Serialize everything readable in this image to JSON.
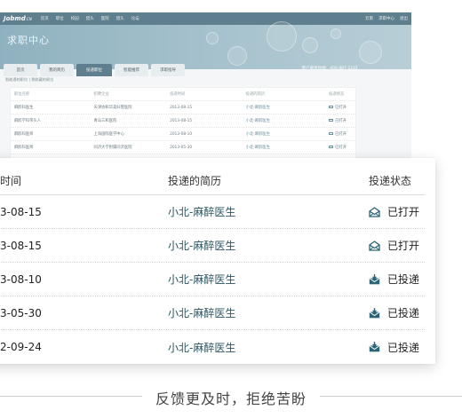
{
  "background_page": {
    "logo": "Jobmd",
    "logo_suffix": ".CN",
    "nav_items": [
      "首页",
      "职位",
      "校园",
      "猎头",
      "医院",
      "猎头",
      "论坛"
    ],
    "nav_right": [
      "云南",
      "求职中心",
      "退出"
    ],
    "page_title": "求职中心",
    "hotline": "客户服务热线：400-887-1101",
    "tabs": [
      "首页",
      "我的简历",
      "投递职位",
      "智能推荐",
      "求职指导"
    ],
    "active_tab": 2,
    "breadcrumb": "智能通的职位 | 我收藏的职位",
    "table": {
      "headers": [
        "职位名称",
        "招聘企业",
        "投递时间",
        "投递的简历",
        "投递状态"
      ],
      "rows": [
        [
          "麻醉科医生",
          "天津协和华美妇婴医院",
          "2013-08-15",
          "小北-麻醉医生",
          "已打开"
        ],
        [
          "麻醉学科带头人",
          "青岛三和医院",
          "2013-08-15",
          "小北-麻醉医生",
          "已打开"
        ],
        [
          "麻醉科医师",
          "上海国际医学中心",
          "2013-08-10",
          "小北-麻醉医生",
          "已打开"
        ],
        [
          "麻醉科医师",
          "同济大学附属同济医院",
          "2013-05-30",
          "小北-麻醉医生",
          "已打开"
        ]
      ]
    }
  },
  "detail_table": {
    "headers": {
      "time": "时间",
      "resume": "投递的简历",
      "status": "投递状态"
    },
    "rows": [
      {
        "time": "3-08-15",
        "resume": "小北-麻醉医生",
        "status": "已打开",
        "status_icon": "envelope-open-icon"
      },
      {
        "time": "3-08-15",
        "resume": "小北-麻醉医生",
        "status": "已打开",
        "status_icon": "envelope-open-icon"
      },
      {
        "time": "3-08-10",
        "resume": "小北-麻醉医生",
        "status": "已投递",
        "status_icon": "envelope-arrow-icon"
      },
      {
        "time": "3-05-30",
        "resume": "小北-麻醉医生",
        "status": "已投递",
        "status_icon": "envelope-arrow-icon"
      },
      {
        "time": "2-09-24",
        "resume": "小北-麻醉医生",
        "status": "已投递",
        "status_icon": "envelope-arrow-icon"
      }
    ]
  },
  "caption": "反馈更及时，拒绝苦盼",
  "colors": {
    "nav": "#5f7f8e",
    "link": "#2c5562",
    "icon": "#2a6475"
  }
}
